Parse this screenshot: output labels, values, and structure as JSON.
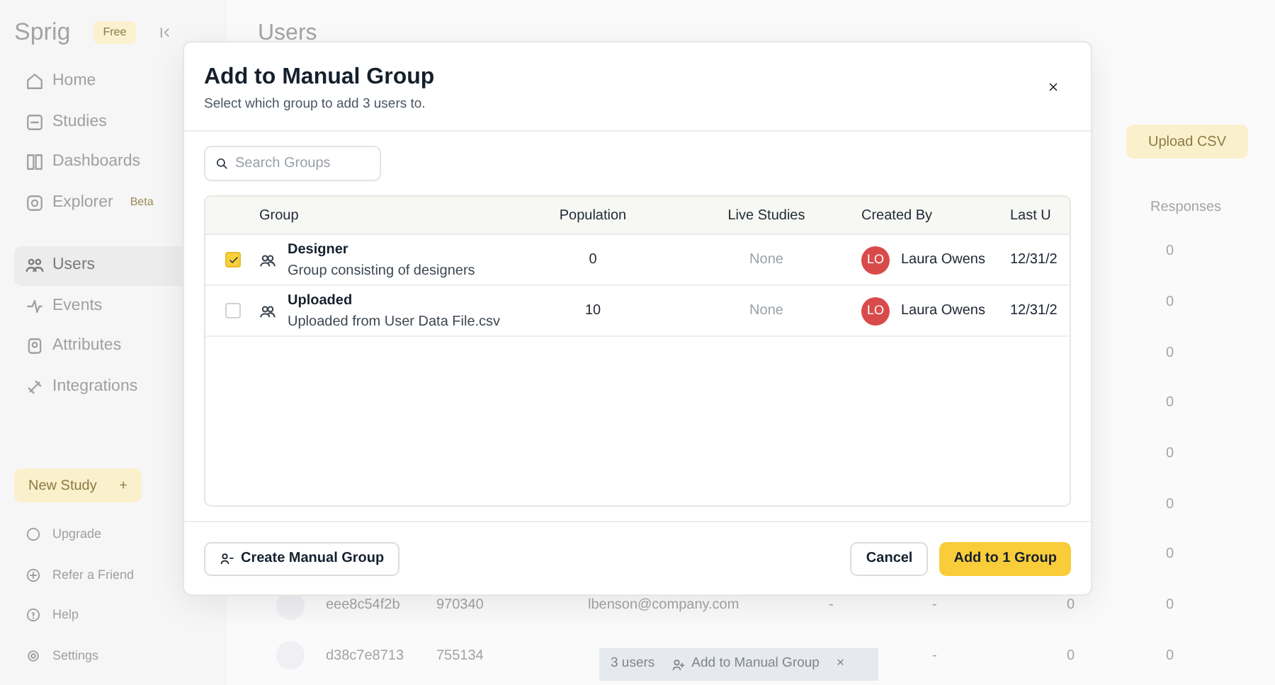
{
  "sidebar": {
    "logo": "Sprig",
    "plan_badge": "Free",
    "nav_groups": [
      [
        {
          "label": "Home",
          "selected": false
        },
        {
          "label": "Studies",
          "selected": false
        },
        {
          "label": "Dashboards",
          "selected": false
        },
        {
          "label": "Explorer",
          "badge": "Beta",
          "selected": false
        }
      ],
      [
        {
          "label": "Users",
          "selected": true
        },
        {
          "label": "Events",
          "selected": false
        },
        {
          "label": "Attributes",
          "selected": false
        },
        {
          "label": "Integrations",
          "selected": false
        }
      ]
    ],
    "new_study_button": {
      "label": "New Study",
      "icon_text": "+"
    },
    "footer_items": [
      {
        "label": "Upgrade"
      },
      {
        "label": "Refer a Friend"
      },
      {
        "label": "Help"
      },
      {
        "label": "Settings"
      }
    ]
  },
  "page": {
    "title": "Users",
    "upload_button": "Upload CSV",
    "responses_header": "Responses",
    "rows": [
      {
        "responses": "0"
      },
      {
        "responses": "0"
      },
      {
        "responses": "0"
      },
      {
        "responses": "0"
      },
      {
        "responses": "0"
      },
      {
        "responses": "0"
      },
      {
        "responses": "0"
      },
      {
        "id": "eee8c54f2b",
        "number": "970340",
        "email": "lbenson@company.com",
        "column_5": "-",
        "column_6": "-",
        "column_7": "0",
        "responses": "0"
      },
      {
        "id": "d38c7e8713",
        "number": "755134",
        "column_6": "-",
        "column_7": "0",
        "responses": "0"
      }
    ]
  },
  "action_bar": {
    "count": "3 users",
    "button": "Add to Manual Group",
    "close": "×"
  },
  "modal": {
    "title": "Add to Manual Group",
    "subtitle": "Select which group to add 3 users to.",
    "search": {
      "placeholder": "Search Groups"
    },
    "columns": [
      "Group",
      "Population",
      "Live Studies",
      "Created By",
      "Last U"
    ],
    "rows": [
      {
        "selected": true,
        "name": "Designer",
        "description": "Group consisting of designers",
        "population": "0",
        "live_studies": "None",
        "creator_initials": "LO",
        "creator": "Laura Owens",
        "last_updated": "12/31/2"
      },
      {
        "selected": false,
        "name": "Uploaded",
        "description": "Uploaded from User Data File.csv",
        "population": "10",
        "live_studies": "None",
        "creator_initials": "LO",
        "creator": "Laura Owens",
        "last_updated": "12/31/2"
      }
    ],
    "create_button": "Create Manual Group",
    "cancel_button": "Cancel",
    "confirm_button": "Add to 1 Group"
  }
}
